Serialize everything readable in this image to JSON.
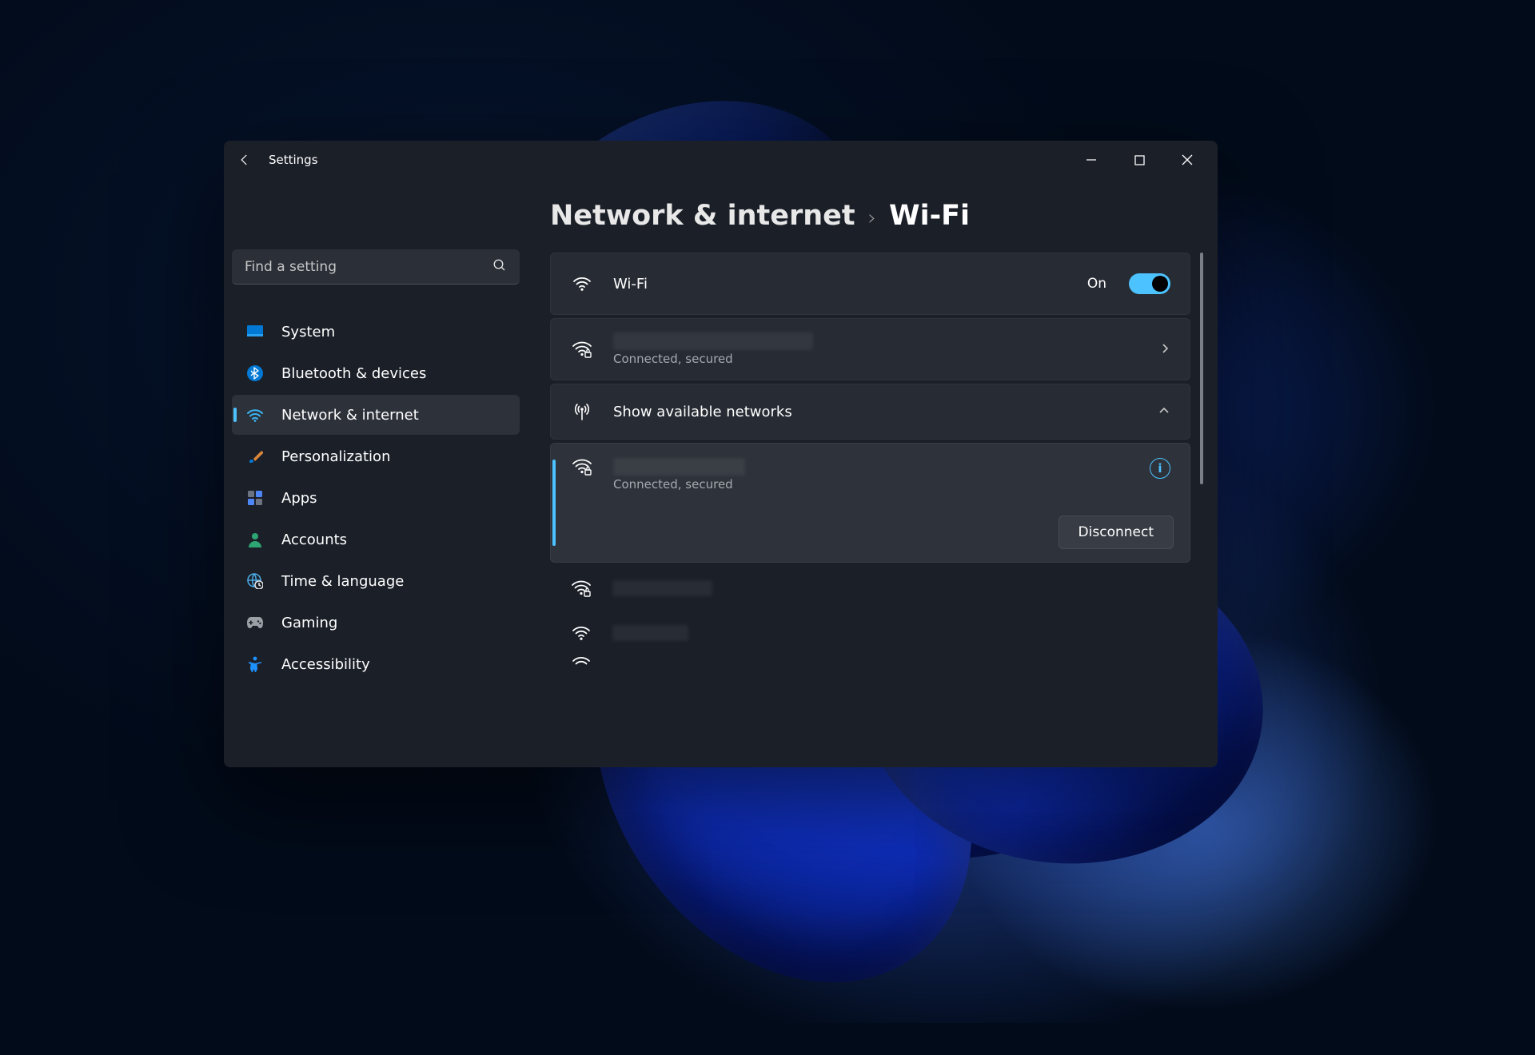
{
  "window": {
    "title": "Settings"
  },
  "search": {
    "placeholder": "Find a setting"
  },
  "sidebar": {
    "items": [
      {
        "label": "System"
      },
      {
        "label": "Bluetooth & devices"
      },
      {
        "label": "Network & internet"
      },
      {
        "label": "Personalization"
      },
      {
        "label": "Apps"
      },
      {
        "label": "Accounts"
      },
      {
        "label": "Time & language"
      },
      {
        "label": "Gaming"
      },
      {
        "label": "Accessibility"
      }
    ],
    "active_index": 2
  },
  "breadcrumb": {
    "parent": "Network & internet",
    "leaf": "Wi-Fi"
  },
  "wifi_toggle": {
    "label": "Wi-Fi",
    "state_text": "On",
    "on": true
  },
  "current_network": {
    "status": "Connected, secured"
  },
  "available": {
    "label": "Show available networks",
    "expanded": true
  },
  "expanded_network": {
    "status": "Connected, secured",
    "disconnect_label": "Disconnect"
  }
}
